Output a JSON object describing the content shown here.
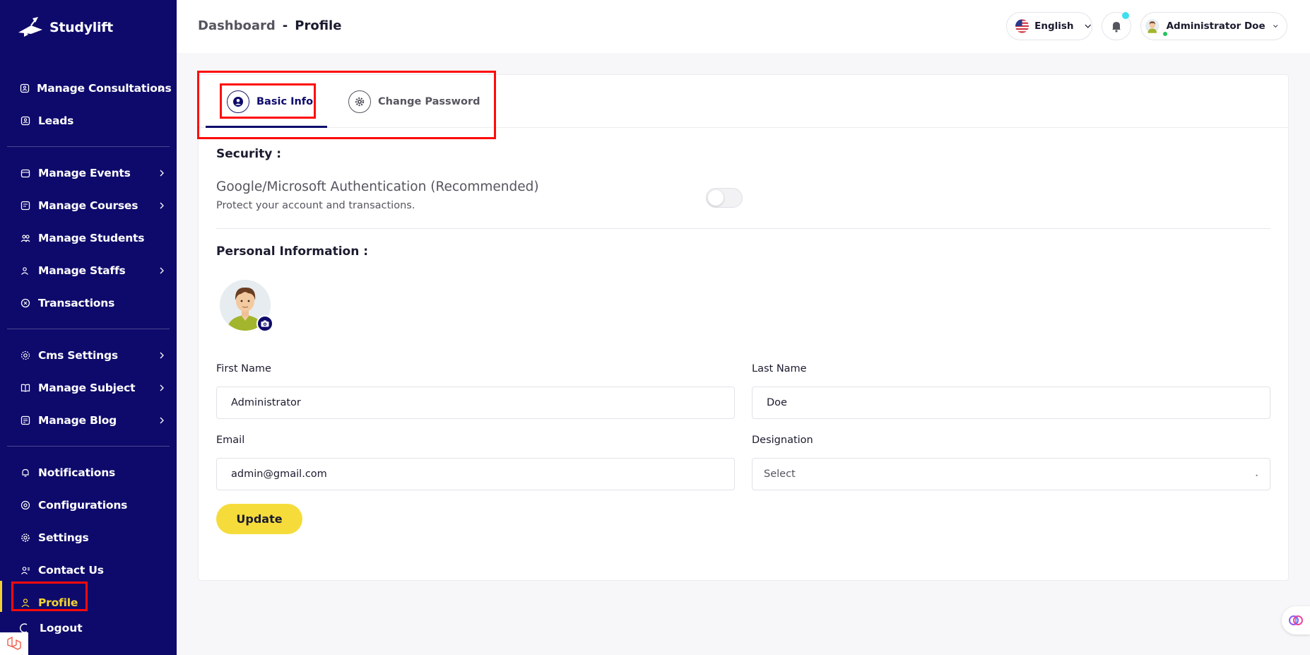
{
  "app": {
    "brand": "Studylift"
  },
  "header": {
    "breadcrumb_root": "Dashboard",
    "breadcrumb_sep": "-",
    "breadcrumb_current": "Profile",
    "language": "English",
    "user_name": "Administrator Doe"
  },
  "sidebar": {
    "items": [
      {
        "label": "Manage Consultations",
        "icon": "consultation-icon",
        "chevron": true
      },
      {
        "label": "Leads",
        "icon": "leads-icon",
        "chevron": false
      },
      {
        "label": "Manage Events",
        "icon": "calendar-icon",
        "chevron": true
      },
      {
        "label": "Manage Courses",
        "icon": "courses-icon",
        "chevron": true
      },
      {
        "label": "Manage Students",
        "icon": "students-icon",
        "chevron": false
      },
      {
        "label": "Manage Staffs",
        "icon": "staffs-icon",
        "chevron": true
      },
      {
        "label": "Transactions",
        "icon": "transactions-icon",
        "chevron": false
      },
      {
        "label": "Cms Settings",
        "icon": "cms-icon",
        "chevron": true
      },
      {
        "label": "Manage Subject",
        "icon": "book-icon",
        "chevron": true
      },
      {
        "label": "Manage Blog",
        "icon": "blog-icon",
        "chevron": true
      },
      {
        "label": "Notifications",
        "icon": "bell-icon",
        "chevron": false
      },
      {
        "label": "Configurations",
        "icon": "config-icon",
        "chevron": false
      },
      {
        "label": "Settings",
        "icon": "gear-icon",
        "chevron": false
      },
      {
        "label": "Contact Us",
        "icon": "contact-icon",
        "chevron": false
      },
      {
        "label": "Profile",
        "icon": "user-icon",
        "chevron": false,
        "active": true
      }
    ],
    "logout": "Logout"
  },
  "tabs": {
    "basic": "Basic Info",
    "password": "Change Password",
    "active": "Basic Info"
  },
  "security": {
    "title": "Security :",
    "auth_title": "Google/Microsoft Authentication (Recommended)",
    "auth_subtitle": "Protect your account and transactions.",
    "auth_enabled": false
  },
  "personal": {
    "title": "Personal Information :",
    "first_name_label": "First Name",
    "first_name": "Administrator",
    "last_name_label": "Last Name",
    "last_name": "Doe",
    "email_label": "Email",
    "email": "admin@gmail.com",
    "designation_label": "Designation",
    "designation": "Select",
    "update": "Update"
  },
  "colors": {
    "sidebar_bg": "#0e0a6b",
    "accent_yellow": "#f2d233",
    "highlight_red": "#ff0a0a",
    "notification_dot": "#3de0ec"
  }
}
